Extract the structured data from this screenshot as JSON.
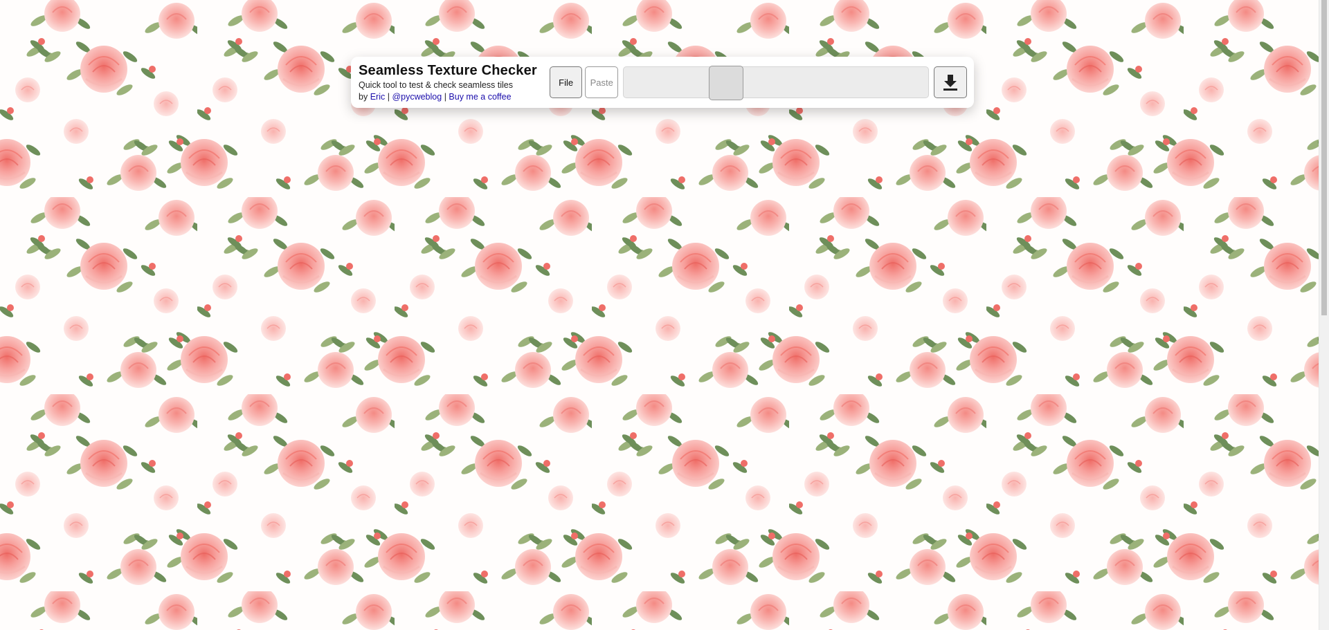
{
  "app": {
    "title": "Seamless Texture Checker",
    "subtitle": "Quick tool to test & check seamless tiles",
    "by_prefix": "by",
    "links": [
      {
        "label": "Eric"
      },
      {
        "label": "@pycweblog"
      },
      {
        "label": "Buy me a coffee"
      }
    ],
    "separator": "|"
  },
  "toolbar": {
    "file_label": "File",
    "paste_label": "Paste",
    "zoom_slider_value": 0.31,
    "download_icon": "download-icon"
  },
  "texture": {
    "description_icon": "rose-pattern",
    "colors": {
      "rose_light": "#fbc2c0",
      "rose_mid": "#f7a09c",
      "rose_dark": "#ef6e68",
      "leaf": "#9bb27a",
      "leaf_dark": "#6e8f5a",
      "background": "#fffdfc"
    }
  }
}
